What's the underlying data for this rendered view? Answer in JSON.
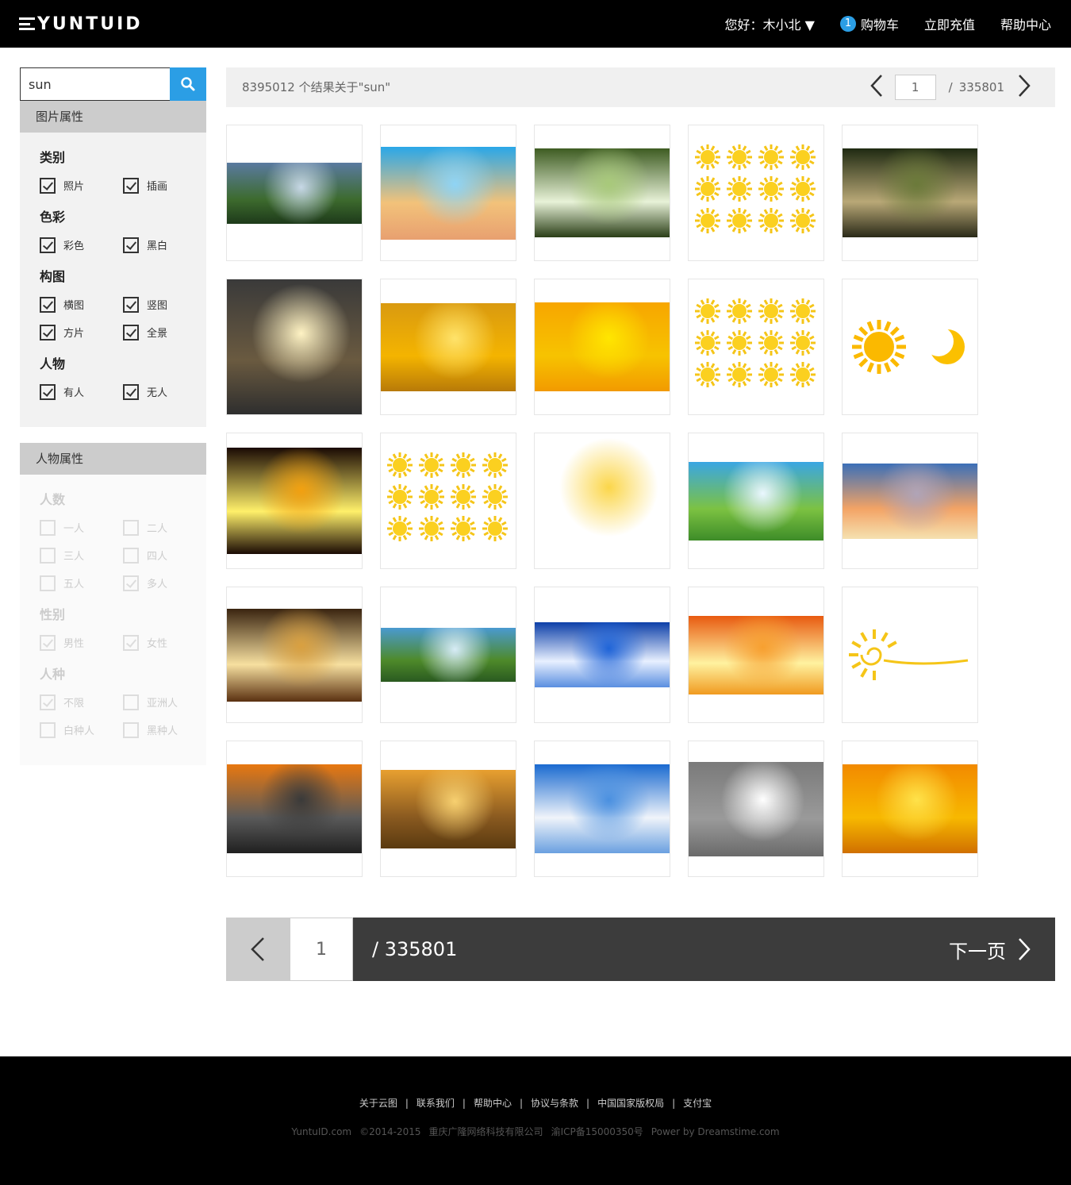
{
  "header": {
    "logo": "YUNTUID",
    "greeting": "您好：木小北 ▼",
    "cart_count": "1",
    "cart_label": "购物车",
    "recharge": "立即充值",
    "help": "帮助中心"
  },
  "search": {
    "value": "sun"
  },
  "filters": {
    "image_attr_title": "图片属性",
    "image_groups": [
      {
        "title": "类别",
        "options": [
          {
            "label": "照片",
            "checked": true
          },
          {
            "label": "插画",
            "checked": true
          }
        ]
      },
      {
        "title": "色彩",
        "options": [
          {
            "label": "彩色",
            "checked": true
          },
          {
            "label": "黑白",
            "checked": true
          }
        ]
      },
      {
        "title": "构图",
        "options": [
          {
            "label": "横图",
            "checked": true
          },
          {
            "label": "竖图",
            "checked": true
          },
          {
            "label": "方片",
            "checked": true
          },
          {
            "label": "全景",
            "checked": true
          }
        ]
      },
      {
        "title": "人物",
        "options": [
          {
            "label": "有人",
            "checked": true
          },
          {
            "label": "无人",
            "checked": true
          }
        ]
      }
    ],
    "people_attr_title": "人物属性",
    "people_groups": [
      {
        "title": "人数",
        "options": [
          {
            "label": "一人",
            "checked": false
          },
          {
            "label": "二人",
            "checked": false
          },
          {
            "label": "三人",
            "checked": false
          },
          {
            "label": "四人",
            "checked": false
          },
          {
            "label": "五人",
            "checked": false
          },
          {
            "label": "多人",
            "checked": true
          }
        ]
      },
      {
        "title": "性别",
        "options": [
          {
            "label": "男性",
            "checked": true
          },
          {
            "label": "女性",
            "checked": true
          }
        ]
      },
      {
        "title": "人种",
        "options": [
          {
            "label": "不限",
            "checked": true
          },
          {
            "label": "亚洲人",
            "checked": false
          },
          {
            "label": "白种人",
            "checked": false
          },
          {
            "label": "黑种人",
            "checked": false
          }
        ]
      }
    ]
  },
  "results": {
    "summary": "8395012 个结果关于\"sun\"",
    "page": "1",
    "total_pages": "335801",
    "slash": "/"
  },
  "thumbnails": [
    {
      "name": "mountain-sunrays",
      "colors": [
        "#5a7aa0",
        "#c7d8e6",
        "#3d6b2e",
        "#1e3a1a"
      ],
      "fill": 0.45
    },
    {
      "name": "blue-sky-sunrays",
      "colors": [
        "#2aa7e8",
        "#8fd4f5",
        "#f2c27a",
        "#e8a070"
      ],
      "fill": 0.69
    },
    {
      "name": "forest-canopy-sun",
      "colors": [
        "#3e5c22",
        "#a8c97a",
        "#e8f2d8",
        "#2b3f18"
      ],
      "fill": 0.66
    },
    {
      "name": "cartoon-sun-set-1",
      "colors": [
        "#ffffff",
        "#ffffff",
        "#ffffff",
        "#ffffff"
      ],
      "fill": 1.0,
      "suns": true
    },
    {
      "name": "forest-road-light",
      "colors": [
        "#1f2a12",
        "#6b7a3a",
        "#b9a877",
        "#2a2a18"
      ],
      "fill": 0.66
    },
    {
      "name": "starburst-transparent",
      "colors": [
        "#3a3a3a",
        "#fff3c4",
        "#6a5a40",
        "#2e2e2e"
      ],
      "fill": 1.0
    },
    {
      "name": "golden-clouds-sun",
      "colors": [
        "#d99a10",
        "#ffe36b",
        "#f4b400",
        "#b87a08"
      ],
      "fill": 0.65
    },
    {
      "name": "yellow-comic-burst",
      "colors": [
        "#f7a600",
        "#ffe600",
        "#f7c300",
        "#f29a00"
      ],
      "fill": 0.66
    },
    {
      "name": "smiley-sun-set",
      "colors": [
        "#ffffff",
        "#ffffff",
        "#ffffff",
        "#ffffff"
      ],
      "fill": 1.0,
      "suns": true
    },
    {
      "name": "sun-and-moon",
      "colors": [
        "#ffffff",
        "#ffffff",
        "#ffffff",
        "#ffffff"
      ],
      "fill": 1.0,
      "sunmoon": true
    },
    {
      "name": "fiery-sun",
      "colors": [
        "#1a0a04",
        "#f2a010",
        "#fff06a",
        "#1a0a04"
      ],
      "fill": 0.79
    },
    {
      "name": "cartoon-sun-set-2",
      "colors": [
        "#ffffff",
        "#ffffff",
        "#ffffff",
        "#ffffff"
      ],
      "fill": 1.0,
      "suns": true
    },
    {
      "name": "sun-burst-white",
      "colors": [
        "#ffffff",
        "#fbd64a",
        "#ffffff",
        "#ffffff"
      ],
      "fill": 1.0
    },
    {
      "name": "green-hills-cartoon",
      "colors": [
        "#3aa6e3",
        "#eaf7ff",
        "#7cc242",
        "#3d8c28"
      ],
      "fill": 0.58
    },
    {
      "name": "sunset-sky",
      "colors": [
        "#3b6fb8",
        "#b0a4b7",
        "#f3a365",
        "#f5e1b0"
      ],
      "fill": 0.56
    },
    {
      "name": "autumn-tree-rays",
      "colors": [
        "#3a2410",
        "#d9a040",
        "#f7e0a0",
        "#5a3010"
      ],
      "fill": 0.69
    },
    {
      "name": "mountain-clouds",
      "colors": [
        "#4a9ad0",
        "#d7ecf6",
        "#4e8a2a",
        "#2a5a20"
      ],
      "fill": 0.4
    },
    {
      "name": "blue-sky-clouds-sun",
      "colors": [
        "#0c3fa8",
        "#1f64d8",
        "#e8f0ff",
        "#5a8ee0"
      ],
      "fill": 0.48
    },
    {
      "name": "orange-sky-sun",
      "colors": [
        "#e85a10",
        "#f7a030",
        "#fff2a0",
        "#f09a20"
      ],
      "fill": 0.58
    },
    {
      "name": "sun-swirl-icon",
      "colors": [
        "#ffffff",
        "#ffffff",
        "#ffffff",
        "#ffffff"
      ],
      "fill": 1.0,
      "swirl": true
    },
    {
      "name": "road-sunset",
      "colors": [
        "#e87810",
        "#3a3a3a",
        "#5a5a5a",
        "#202020"
      ],
      "fill": 0.66
    },
    {
      "name": "cracked-earth-sunset",
      "colors": [
        "#e8a030",
        "#f7d070",
        "#8a5a20",
        "#5a3a10"
      ],
      "fill": 0.58
    },
    {
      "name": "blue-sky-white-clouds",
      "colors": [
        "#1a6ad0",
        "#4a90e0",
        "#f0f4fa",
        "#6aa0e0"
      ],
      "fill": 0.66
    },
    {
      "name": "lens-flare-transparent",
      "colors": [
        "#7a7a7a",
        "#ffffff",
        "#9a9a9a",
        "#6a6a6a"
      ],
      "fill": 0.7
    },
    {
      "name": "golden-sky-clouds",
      "colors": [
        "#f28a00",
        "#ffe24a",
        "#f7b800",
        "#d07000"
      ],
      "fill": 0.66
    }
  ],
  "pagination": {
    "page": "1",
    "total": "/ 335801",
    "next_label": "下一页"
  },
  "footer": {
    "links": [
      "关于云图",
      "联系我们",
      "帮助中心",
      "协议与条款",
      "中国国家版权局",
      "支付宝"
    ],
    "separator": "|",
    "info": [
      "YuntuID.com",
      "©2014-2015",
      "重庆广隆网络科技有限公司",
      "渝ICP备15000350号",
      "Power by Dreamstime.com"
    ]
  }
}
